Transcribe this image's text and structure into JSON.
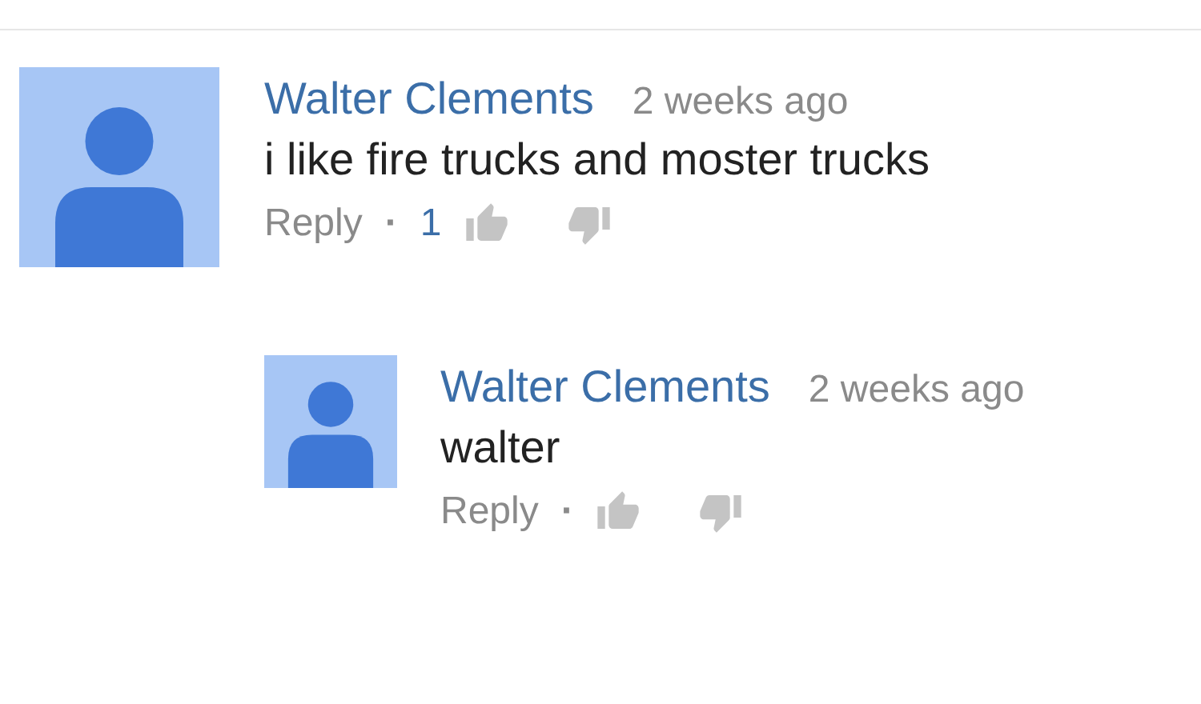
{
  "comments": [
    {
      "author": "Walter Clements",
      "time": "2 weeks ago",
      "text": "i like fire trucks and moster trucks",
      "reply_label": "Reply",
      "separator": "·",
      "likes": "1",
      "replies": [
        {
          "author": "Walter Clements",
          "time": "2 weeks ago",
          "text": "walter",
          "reply_label": "Reply",
          "separator": "·"
        }
      ]
    }
  ]
}
